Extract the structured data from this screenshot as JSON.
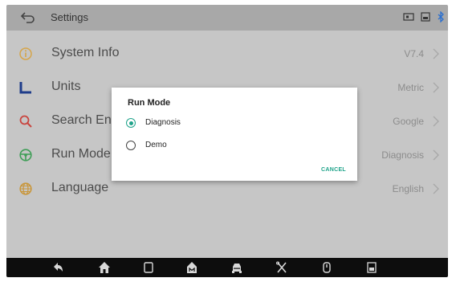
{
  "status_bar": {
    "title": "Settings",
    "icons": [
      "back-icon",
      "screen-record-icon",
      "screenshot-icon",
      "bluetooth-icon"
    ]
  },
  "settings": {
    "items": [
      {
        "label": "System Info",
        "value": "V7.4",
        "icon": "info-icon",
        "icon_color": "#d6a54a"
      },
      {
        "label": "Units",
        "value": "Metric",
        "icon": "units-icon",
        "icon_color": "#1f3c8a"
      },
      {
        "label": "Search Engine",
        "value": "Google",
        "icon": "search-icon",
        "icon_color": "#c9453f"
      },
      {
        "label": "Run Mode",
        "value": "Diagnosis",
        "icon": "steering-wheel-icon",
        "icon_color": "#3f9e57"
      },
      {
        "label": "Language",
        "value": "English",
        "icon": "language-icon",
        "icon_color": "#c9963a"
      }
    ]
  },
  "dialog": {
    "title": "Run Mode",
    "options": [
      {
        "label": "Diagnosis",
        "selected": true
      },
      {
        "label": "Demo",
        "selected": false
      }
    ],
    "cancel_label": "CANCEL",
    "accent_color": "#1fa38a"
  },
  "nav_bar": {
    "icons": [
      "back-nav-icon",
      "home-icon",
      "recent-apps-icon",
      "vci-icon",
      "car-icon",
      "tools-icon",
      "diagnostics-icon",
      "screenshot-nav-icon"
    ]
  }
}
